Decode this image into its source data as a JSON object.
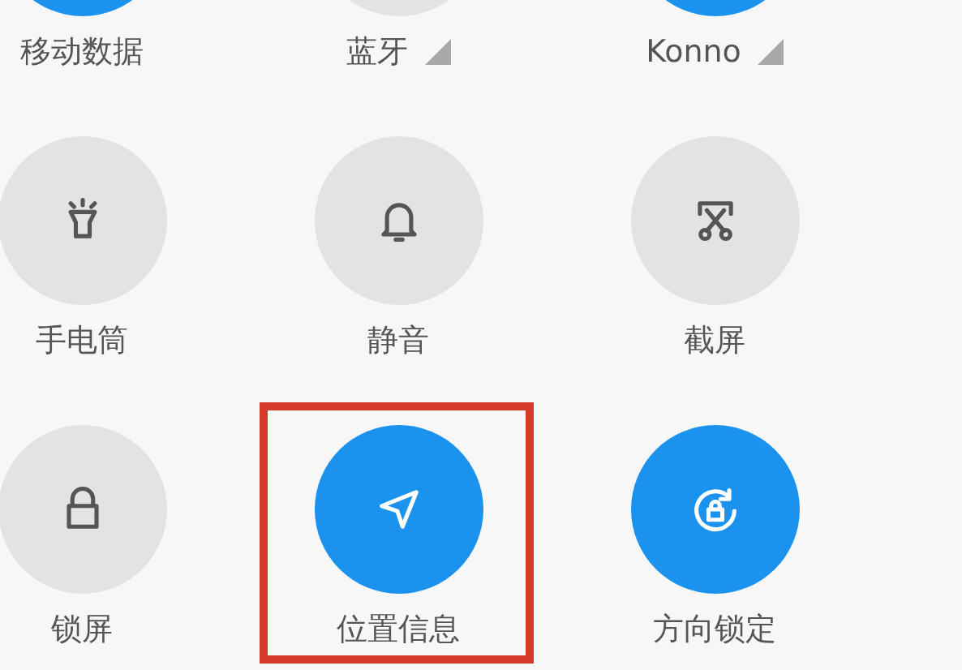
{
  "rows": [
    [
      {
        "label": "移动数据",
        "kind": "data",
        "on": true,
        "dropdown": false,
        "highlighted": false
      },
      {
        "label": "蓝牙",
        "kind": "bluetooth",
        "on": false,
        "dropdown": true,
        "highlighted": false
      },
      {
        "label": "Konno",
        "kind": "wifi",
        "on": true,
        "dropdown": true,
        "highlighted": false
      }
    ],
    [
      {
        "label": "手电筒",
        "kind": "flashlight",
        "on": false,
        "dropdown": false,
        "highlighted": false
      },
      {
        "label": "静音",
        "kind": "bell",
        "on": false,
        "dropdown": false,
        "highlighted": false
      },
      {
        "label": "截屏",
        "kind": "screenshot",
        "on": false,
        "dropdown": false,
        "highlighted": false
      }
    ],
    [
      {
        "label": "锁屏",
        "kind": "lock",
        "on": false,
        "dropdown": false,
        "highlighted": false
      },
      {
        "label": "位置信息",
        "kind": "location",
        "on": true,
        "dropdown": false,
        "highlighted": true
      },
      {
        "label": "方向锁定",
        "kind": "rotation",
        "on": true,
        "dropdown": false,
        "highlighted": false
      }
    ]
  ]
}
